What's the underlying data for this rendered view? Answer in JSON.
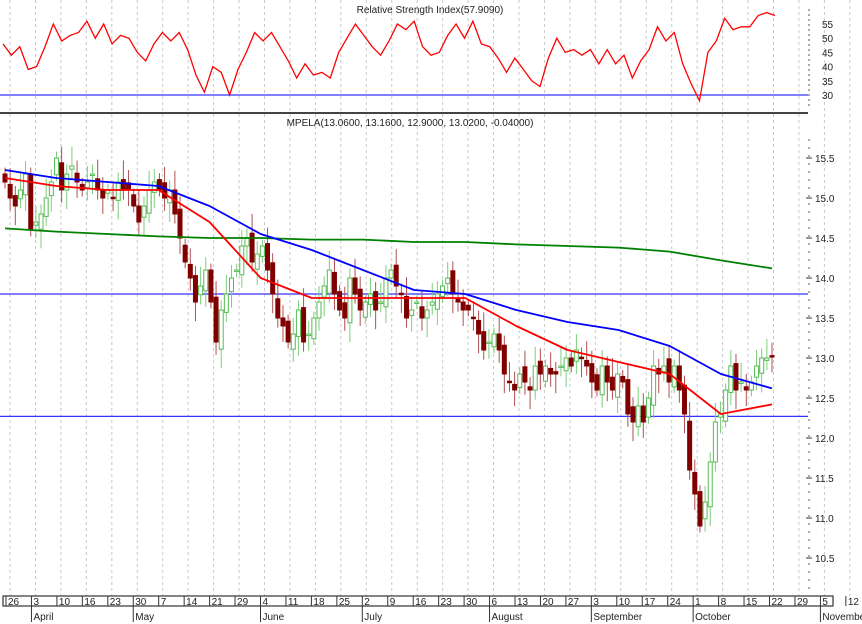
{
  "chart_data": [
    {
      "type": "line",
      "title": "Relative Strength Index",
      "title_value": "(57.9090)",
      "y_ticks": [
        30,
        35,
        40,
        45,
        50,
        55
      ],
      "ylim": [
        25,
        60
      ],
      "reference_line": 30,
      "colors": {
        "rsi": "#ff0000",
        "reference": "#3333ff"
      },
      "values": [
        48,
        44,
        47,
        39,
        40,
        47,
        55,
        49,
        51,
        52,
        56,
        50,
        55,
        48,
        51,
        50,
        45,
        42,
        48,
        52,
        49,
        52,
        46,
        37,
        31,
        40,
        38,
        30,
        39,
        45,
        52,
        49,
        52,
        47,
        42,
        36,
        41,
        37,
        38,
        36,
        45,
        50,
        55,
        51,
        47,
        44,
        49,
        55,
        53,
        56,
        47,
        44,
        45,
        51,
        55,
        50,
        56,
        48,
        47,
        43,
        38,
        43,
        39,
        35,
        33,
        43,
        50,
        45,
        46,
        44,
        46,
        41,
        46,
        41,
        44,
        36,
        42,
        46,
        54,
        49,
        52,
        41,
        34,
        28,
        45,
        49,
        57,
        53,
        54,
        54,
        58,
        59,
        58
      ]
    },
    {
      "type": "candlestick",
      "title": "MPELA",
      "title_values": "(13.0600, 13.1600, 12.9000, 13.0200, -0.04000)",
      "ylim": [
        10.2,
        15.7
      ],
      "y_ticks": [
        "10.5",
        "11.0",
        "11.5",
        "12.0",
        "12.5",
        "13.0",
        "13.5",
        "14.0",
        "14.5",
        "15.0",
        "15.5"
      ],
      "horizontal_lines": [
        13.8,
        12.27
      ],
      "colors": {
        "up": "#33aa33",
        "down": "#800000",
        "ma_fast": "#ff0000",
        "ma_mid": "#0000ff",
        "ma_slow": "#008000",
        "hline": "#3333ff"
      },
      "closes": [
        15.2,
        15.0,
        14.9,
        15.1,
        15.3,
        14.6,
        14.7,
        14.8,
        15.0,
        15.2,
        15.5,
        15.1,
        15.3,
        15.4,
        15.2,
        15.1,
        15.2,
        15.3,
        15.1,
        15.0,
        15.1,
        15.0,
        15.2,
        15.1,
        15.1,
        14.9,
        14.7,
        14.9,
        15.1,
        15.2,
        15.1,
        15.0,
        15.1,
        14.8,
        14.5,
        14.2,
        14.0,
        13.7,
        13.9,
        14.1,
        13.7,
        13.2,
        13.6,
        13.8,
        14.0,
        14.1,
        14.4,
        14.5,
        14.2,
        14.3,
        14.4,
        14.1,
        13.8,
        13.5,
        13.4,
        13.2,
        13.3,
        13.6,
        13.2,
        13.3,
        13.5,
        13.7,
        13.9,
        14.1,
        13.8,
        13.6,
        13.5,
        14.0,
        13.8,
        13.6,
        13.7,
        13.8,
        13.6,
        13.7,
        14.0,
        14.1,
        13.9,
        13.8,
        13.5,
        13.6,
        13.7,
        13.5,
        13.6,
        13.7,
        13.8,
        13.9,
        14.0,
        13.8,
        13.7,
        13.6,
        13.6,
        13.5,
        13.3,
        13.1,
        13.2,
        13.3,
        13.1,
        12.8,
        12.7,
        12.6,
        12.8,
        12.7,
        12.6,
        12.9,
        12.8,
        12.9,
        12.8,
        12.8,
        12.9,
        13.0,
        12.9,
        13.1,
        13.0,
        12.9,
        12.7,
        12.6,
        12.9,
        12.7,
        12.6,
        12.8,
        12.7,
        12.3,
        12.2,
        12.4,
        12.2,
        12.5,
        12.9,
        12.8,
        12.9,
        12.7,
        12.9,
        12.6,
        12.3,
        11.6,
        11.3,
        10.9,
        11.2,
        11.7,
        12.2,
        12.3,
        12.6,
        12.9,
        12.6,
        12.7,
        12.6,
        12.7,
        12.9,
        13.0,
        13.0,
        13.02
      ],
      "ma_fast": [
        15.25,
        15.15,
        15.1,
        15.1,
        14.7,
        14.0,
        13.75,
        13.75,
        13.75,
        13.75,
        13.4,
        13.1,
        12.95,
        12.8,
        12.3,
        12.42
      ],
      "ma_mid": [
        15.35,
        15.25,
        15.2,
        15.15,
        14.9,
        14.55,
        14.35,
        14.1,
        13.85,
        13.8,
        13.6,
        13.45,
        13.35,
        13.15,
        12.8,
        12.62
      ],
      "ma_slow": [
        14.62,
        14.58,
        14.55,
        14.52,
        14.5,
        14.5,
        14.48,
        14.48,
        14.45,
        14.45,
        14.42,
        14.4,
        14.38,
        14.33,
        14.22,
        14.12
      ]
    }
  ],
  "x_axis": {
    "day_labels": [
      "26",
      "3",
      "10",
      "16",
      "23",
      "30",
      "7",
      "14",
      "21",
      "29",
      "4",
      "11",
      "18",
      "25",
      "2",
      "9",
      "16",
      "23",
      "30",
      "6",
      "13",
      "20",
      "27",
      "3",
      "10",
      "17",
      "24",
      "1",
      "8",
      "15",
      "22",
      "29",
      "5",
      "12"
    ],
    "months": [
      {
        "label": "April",
        "week_index": 1
      },
      {
        "label": "May",
        "week_index": 5
      },
      {
        "label": "June",
        "week_index": 10
      },
      {
        "label": "July",
        "week_index": 14
      },
      {
        "label": "August",
        "week_index": 19
      },
      {
        "label": "September",
        "week_index": 23
      },
      {
        "label": "October",
        "week_index": 27
      },
      {
        "label": "November",
        "week_index": 32
      }
    ]
  }
}
